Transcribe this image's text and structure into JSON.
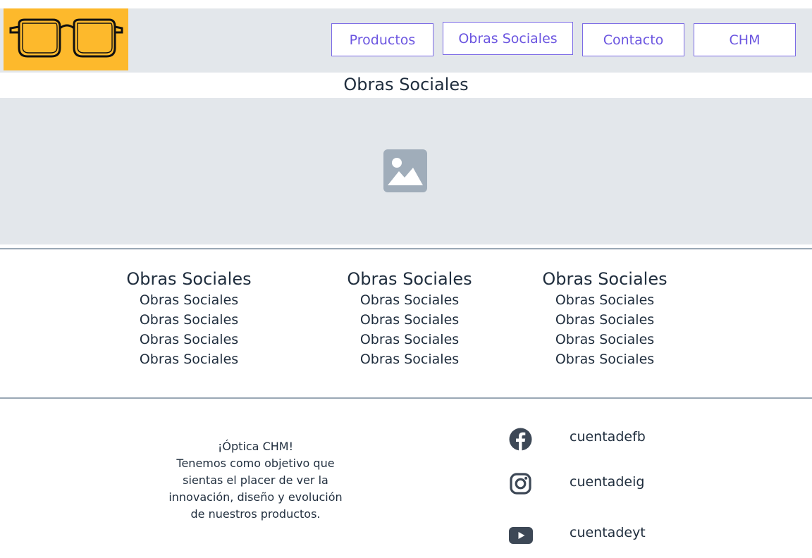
{
  "nav": {
    "items": [
      {
        "label": "Productos"
      },
      {
        "label": "Obras Sociales"
      },
      {
        "label": "Contacto"
      },
      {
        "label": "CHM"
      }
    ]
  },
  "page": {
    "title": "Obras Sociales"
  },
  "hero": {
    "icon": "image-placeholder-icon"
  },
  "columns": [
    {
      "title": "Obras Sociales",
      "items": [
        "Obras Sociales",
        "Obras Sociales",
        "Obras Sociales",
        "Obras Sociales"
      ]
    },
    {
      "title": "Obras Sociales",
      "items": [
        "Obras Sociales",
        "Obras Sociales",
        "Obras Sociales",
        "Obras Sociales"
      ]
    },
    {
      "title": "Obras Sociales",
      "items": [
        "Obras Sociales",
        "Obras Sociales",
        "Obras Sociales",
        "Obras Sociales"
      ]
    }
  ],
  "footer": {
    "about_lines": [
      "¡Óptica CHM!",
      "Tenemos como objetivo que",
      "sientas el placer de ver la",
      "innovación, diseño y evolución",
      "de nuestros productos."
    ],
    "social": [
      {
        "icon": "facebook-icon",
        "label": "cuentadefb"
      },
      {
        "icon": "instagram-icon",
        "label": "cuentadeig"
      },
      {
        "icon": "youtube-icon",
        "label": "cuentadeyt"
      }
    ]
  },
  "colors": {
    "accent": "#6b55e0",
    "logo_bg": "#fdb92c",
    "panel_bg": "#e3e7eb",
    "icon": "#3d4856"
  }
}
